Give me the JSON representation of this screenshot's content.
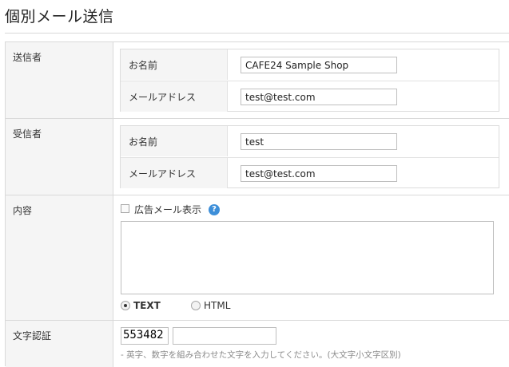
{
  "page": {
    "title": "個別メール送信"
  },
  "sender": {
    "label": "送信者",
    "name_label": "お名前",
    "name_value": "CAFE24 Sample Shop",
    "email_label": "メールアドレス",
    "email_value": "test@test.com"
  },
  "recipient": {
    "label": "受信者",
    "name_label": "お名前",
    "name_value": "test",
    "email_label": "メールアドレス",
    "email_value": "test@test.com"
  },
  "content": {
    "label": "内容",
    "ad_checkbox_label": "広告メール表示",
    "ad_checked": false,
    "help_icon": "?",
    "body_value": "",
    "format_options": [
      {
        "label": "TEXT",
        "selected": true
      },
      {
        "label": "HTML",
        "selected": false
      }
    ]
  },
  "captcha": {
    "label": "文字認証",
    "code": "553482",
    "input_value": "",
    "note": "- 英字、数字を組み合わせた文字を入力してください。(大文字小文字区別)"
  }
}
